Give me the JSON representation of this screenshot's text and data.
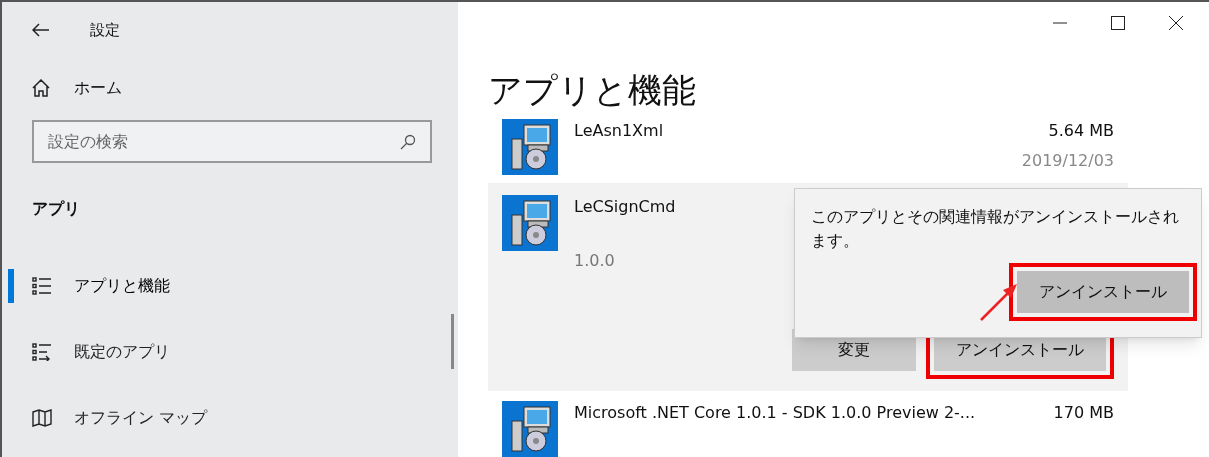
{
  "window": {
    "title": "設定"
  },
  "sidebar": {
    "home": "ホーム",
    "search": {
      "placeholder": "設定の検索"
    },
    "section": "アプリ",
    "items": [
      {
        "label": "アプリと機能",
        "kind": "features",
        "selected": true
      },
      {
        "label": "既定のアプリ",
        "kind": "defaults",
        "selected": false
      },
      {
        "label": "オフライン マップ",
        "kind": "maps",
        "selected": false
      }
    ]
  },
  "main": {
    "title": "アプリと機能",
    "apps": [
      {
        "name": "LeAsn1Xml",
        "size": "5.64 MB",
        "date": "2019/12/03",
        "selected": false
      },
      {
        "name": "LeCSignCmd",
        "version": "1.0.0",
        "selected": true,
        "buttons": [
          {
            "label": "変更",
            "highlighted": false
          },
          {
            "label": "アンインストール",
            "highlighted": true
          }
        ]
      },
      {
        "name": "Microsoft .NET Core 1.0.1 - SDK 1.0.0 Preview 2-...",
        "size": "170 MB",
        "selected": false
      }
    ]
  },
  "popup": {
    "message": "このアプリとその関連情報がアンインストールされます。",
    "button": {
      "label": "アンインストール",
      "highlighted": true
    }
  }
}
